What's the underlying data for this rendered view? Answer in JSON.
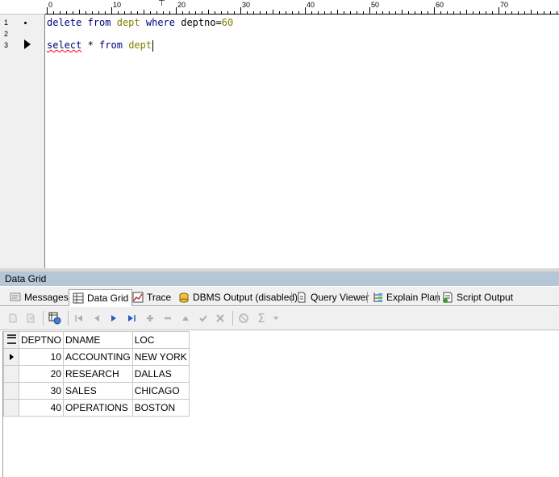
{
  "editor": {
    "ruler_numbers": [
      "0",
      "10",
      "20",
      "30",
      "40",
      "50",
      "60",
      "70"
    ],
    "ruler_marker": "⊤",
    "line_numbers": [
      "1",
      "2",
      "3"
    ],
    "lines": [
      {
        "parts": [
          {
            "text": "delete",
            "style": "kw"
          },
          {
            "text": " ",
            "style": ""
          },
          {
            "text": "from",
            "style": "kw"
          },
          {
            "text": " ",
            "style": ""
          },
          {
            "text": "dept",
            "style": "tb"
          },
          {
            "text": " ",
            "style": ""
          },
          {
            "text": "where",
            "style": "kw"
          },
          {
            "text": " deptno=",
            "style": ""
          },
          {
            "text": "60",
            "style": "num"
          }
        ]
      },
      {
        "parts": []
      },
      {
        "parts": [
          {
            "text": "select",
            "style": "kw sq"
          },
          {
            "text": " * ",
            "style": ""
          },
          {
            "text": "from",
            "style": "kw"
          },
          {
            "text": " ",
            "style": ""
          },
          {
            "text": "dept",
            "style": "tb"
          }
        ]
      }
    ]
  },
  "panel": {
    "title": "Data Grid",
    "tabs": [
      {
        "label": "Messages",
        "icon": "messages-icon"
      },
      {
        "label": "Data Grid",
        "icon": "data-grid-icon",
        "active": true
      },
      {
        "label": "Trace",
        "icon": "trace-icon"
      },
      {
        "label": "DBMS Output (disabled)",
        "icon": "dbms-output-icon"
      },
      {
        "label": "Query Viewer",
        "icon": "query-viewer-icon"
      },
      {
        "label": "Explain Plan",
        "icon": "explain-plan-icon"
      },
      {
        "label": "Script Output",
        "icon": "script-output-icon"
      }
    ]
  },
  "toolbar": {
    "icons": [
      "export-icon",
      "save-icon",
      "grid-options-icon",
      "first-record-icon",
      "prior-record-icon",
      "next-record-icon",
      "last-record-icon",
      "insert-record-icon",
      "delete-record-icon",
      "edit-record-icon",
      "post-edit-icon",
      "cancel-edit-icon",
      "refresh-icon",
      "sum-icon",
      "dropdown-icon"
    ]
  },
  "grid": {
    "columns": [
      "DEPTNO",
      "DNAME",
      "LOC"
    ],
    "rows": [
      [
        "10",
        "ACCOUNTING",
        "NEW YORK"
      ],
      [
        "20",
        "RESEARCH",
        "DALLAS"
      ],
      [
        "30",
        "SALES",
        "CHICAGO"
      ],
      [
        "40",
        "OPERATIONS",
        "BOSTON"
      ]
    ],
    "current_row": 0
  },
  "colors": {
    "keyword": "#000080",
    "table_name": "#808000",
    "panel_title_bg": "#b5c6d6"
  }
}
